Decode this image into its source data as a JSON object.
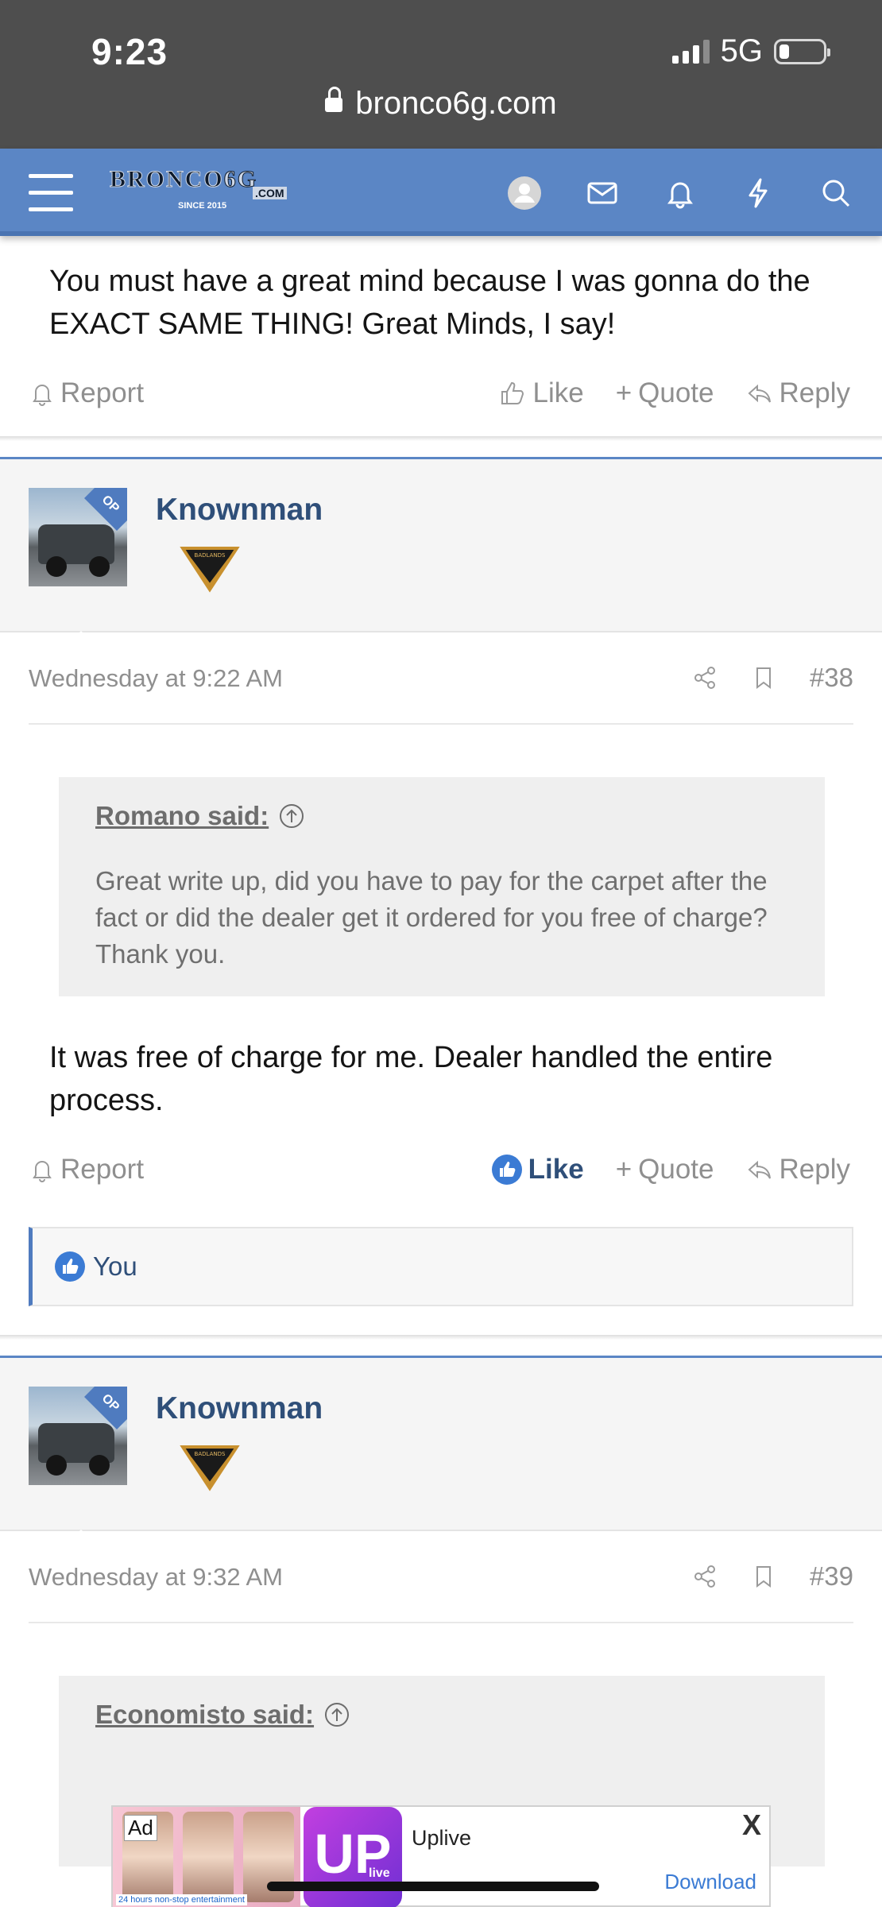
{
  "status_bar": {
    "time": "9:23",
    "network": "5G"
  },
  "url_bar": {
    "domain": "bronco6g.com"
  },
  "site_header": {
    "logo_text_main": "BRONCO",
    "logo_text_six": "6G",
    "logo_com": ".COM",
    "logo_since": "SINCE 2015",
    "icons": [
      "menu-icon",
      "avatar-icon",
      "inbox-icon",
      "bell-icon",
      "bolt-icon",
      "search-icon"
    ]
  },
  "prev_post": {
    "body": "You must have a great mind because I was gonna do the EXACT SAME THING! Great Minds, I say!",
    "report": "Report",
    "like": "Like",
    "quote": "Quote",
    "reply": "Reply"
  },
  "posts": [
    {
      "username": "Knownman",
      "op_label": "OP",
      "badge_text": "BADLANDS",
      "date": "Wednesday at 9:22 AM",
      "number": "#38",
      "quote_author": "Romano said:",
      "quote_text": "Great write up, did you have to pay for the carpet after the fact or did the dealer get it ordered for you free of charge? Thank you.",
      "body": "It was free of charge for me. Dealer handled the entire process.",
      "report": "Report",
      "like": "Like",
      "quote": "Quote",
      "reply": "Reply",
      "reactions": "You"
    },
    {
      "username": "Knownman",
      "op_label": "OP",
      "badge_text": "BADLANDS",
      "date": "Wednesday at 9:32 AM",
      "number": "#39",
      "quote_author": "Economisto said:"
    }
  ],
  "ad": {
    "tag": "Ad",
    "sub_tag": "24 hours non-stop entertainment",
    "logo": "UP",
    "logo_sub": "live",
    "title": "Uplive",
    "cta": "Download",
    "close": "X"
  },
  "colors": {
    "header_blue": "#5b86c5",
    "accent": "#2f4f79",
    "status_bar": "#4e4e4e"
  }
}
